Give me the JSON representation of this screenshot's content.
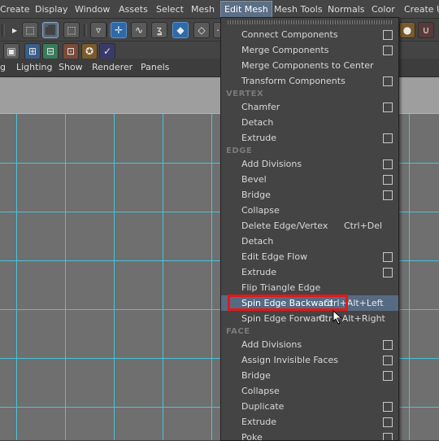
{
  "menubar": {
    "items": [
      "Create",
      "Display",
      "Window",
      "Assets",
      "Select",
      "Mesh",
      "Edit Mesh",
      "Mesh Tools",
      "Normals",
      "Color",
      "Create UI"
    ],
    "active_index": 6
  },
  "panel_menus": [
    "g",
    "Lighting",
    "Show",
    "Renderer",
    "Panels"
  ],
  "toolbar_icons": {
    "move": "move-icon",
    "lasso": "lasso-icon",
    "paint": "paint-select-icon",
    "magnet": "magnet-icon",
    "snap_curve": "snap-curve-icon",
    "snap_grid": "snap-grid-icon"
  },
  "dropdown": {
    "top_items": [
      {
        "label": "Connect Components",
        "shortcut": "",
        "option_box": true
      },
      {
        "label": "Merge Components",
        "shortcut": "",
        "option_box": true
      },
      {
        "label": "Merge Components to Center",
        "shortcut": "",
        "option_box": false
      },
      {
        "label": "Transform Components",
        "shortcut": "",
        "option_box": true
      }
    ],
    "vertex_heading": "VERTEX",
    "vertex_items": [
      {
        "label": "Chamfer",
        "shortcut": "",
        "option_box": true
      },
      {
        "label": "Detach",
        "shortcut": "",
        "option_box": false
      },
      {
        "label": "Extrude",
        "shortcut": "",
        "option_box": true
      }
    ],
    "edge_heading": "EDGE",
    "edge_items": [
      {
        "label": "Add Divisions",
        "shortcut": "",
        "option_box": true
      },
      {
        "label": "Bevel",
        "shortcut": "",
        "option_box": true
      },
      {
        "label": "Bridge",
        "shortcut": "",
        "option_box": true
      },
      {
        "label": "Collapse",
        "shortcut": "",
        "option_box": false
      },
      {
        "label": "Delete Edge/Vertex",
        "shortcut": "Ctrl+Del",
        "option_box": false
      },
      {
        "label": "Detach",
        "shortcut": "",
        "option_box": false
      },
      {
        "label": "Edit Edge Flow",
        "shortcut": "",
        "option_box": true
      },
      {
        "label": "Extrude",
        "shortcut": "",
        "option_box": true
      },
      {
        "label": "Flip Triangle Edge",
        "shortcut": "",
        "option_box": false
      },
      {
        "label": "Spin Edge Backward",
        "shortcut": "Ctrl+Alt+Left",
        "option_box": false,
        "highlighted": true
      },
      {
        "label": "Spin Edge Forward",
        "shortcut": "Ctrl+Alt+Right",
        "option_box": false
      }
    ],
    "face_heading": "FACE",
    "face_items": [
      {
        "label": "Add Divisions",
        "shortcut": "",
        "option_box": true
      },
      {
        "label": "Assign Invisible Faces",
        "shortcut": "",
        "option_box": true
      },
      {
        "label": "Bridge",
        "shortcut": "",
        "option_box": true
      },
      {
        "label": "Collapse",
        "shortcut": "",
        "option_box": false
      },
      {
        "label": "Duplicate",
        "shortcut": "",
        "option_box": true
      },
      {
        "label": "Extrude",
        "shortcut": "",
        "option_box": true
      },
      {
        "label": "Poke",
        "shortcut": "",
        "option_box": true
      }
    ]
  },
  "colors": {
    "highlight": "#566b83",
    "annotation_red": "#e81616",
    "grid_line": "#48c4da",
    "menu_bg": "#444444"
  }
}
